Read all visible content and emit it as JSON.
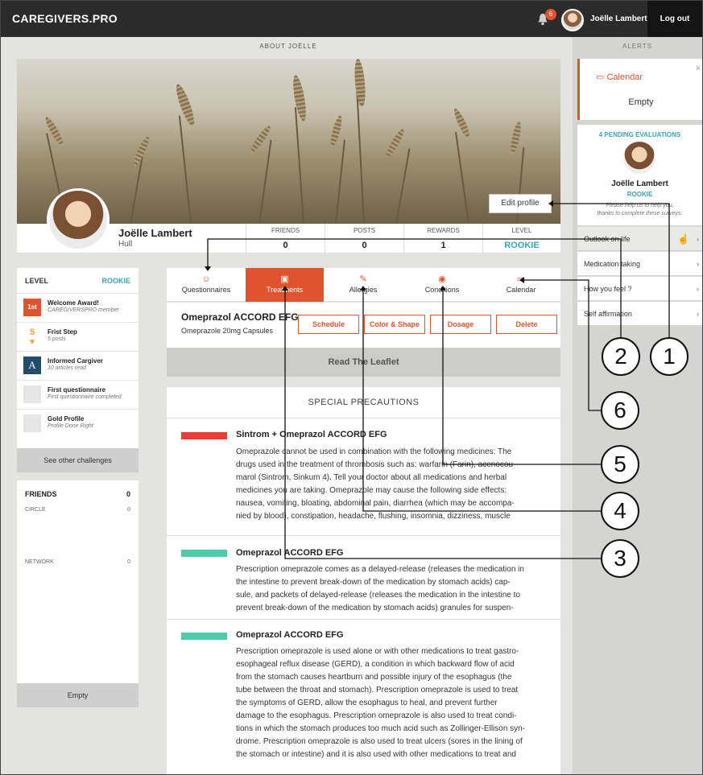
{
  "topbar": {
    "brand": "CAREGIVERS.PRO",
    "notifications": "6",
    "user": "Joëlle Lambert",
    "logout": "Log out"
  },
  "about_header": "ABOUT JOËLLE",
  "alerts_header": "ALERTS",
  "profile": {
    "name": "Joëlle Lambert",
    "city": "Hull",
    "edit_label": "Edit profile",
    "stats": [
      {
        "label": "FRIENDS",
        "value": "0"
      },
      {
        "label": "POSTS",
        "value": "0"
      },
      {
        "label": "REWARDS",
        "value": "1"
      },
      {
        "label": "LEVEL",
        "value": "ROOKIE"
      }
    ]
  },
  "level_box": {
    "title": "LEVEL",
    "value": "ROOKIE",
    "achievements": [
      {
        "icon": "1st",
        "title": "Welcome Award!",
        "sub": "CAREGIVERSPRO  member"
      },
      {
        "icon": "5",
        "title": "Frist Step",
        "sub": "5 posts"
      },
      {
        "icon": "A",
        "title": "Informed Cargiver",
        "sub": "10 articles read"
      },
      {
        "icon": "",
        "title": "First questionnaire",
        "sub": "First questionnaire completed"
      },
      {
        "icon": "",
        "title": "Gold Profile",
        "sub": "Profile Done Right"
      }
    ],
    "see_other": "See other challenges"
  },
  "friends_box": {
    "title": "FRIENDS",
    "count": "0",
    "circle_label": "CIRCLE",
    "circle_count": "0",
    "network_label": "NETWORK",
    "network_count": "0",
    "empty": "Empty"
  },
  "tabs": [
    {
      "icon": "☺",
      "label": "Questionnaires"
    },
    {
      "icon": "▣",
      "label": "Treatments"
    },
    {
      "icon": "✎",
      "label": "Allergies"
    },
    {
      "icon": "◉",
      "label": "Conditions"
    },
    {
      "icon": "▭",
      "label": "Calendar"
    }
  ],
  "medication": {
    "name": "Omeprazol ACCORD EFG",
    "sub": "Omeprazole 20mg Capsules",
    "buttons": [
      "Schedule",
      "Color & Shape",
      "Dosage",
      "Delete"
    ],
    "leaflet": "Read The Leaflet"
  },
  "precautions": {
    "title": "SPECIAL PRECAUTIONS",
    "colors": {
      "danger": "#ee3d32",
      "ok": "#4ecba8"
    },
    "sections": [
      {
        "title": "Sintrom + Omeprazol ACCORD EFG",
        "lines": [
          "Omeprazole cannot be used in combination with the following medicines: The",
          "drugs used in the treatment of thrombosis such as: warfarin (Farin), acenocou-",
          "marol (Sintrom, Sinkum 4). Tell your doctor about all medications and herbal",
          "medicines you are taking. Omeprazole may cause the following side effects:",
          "nausea, vomiting, bloating, abdominal pain, diarrhea (which may be accompa-",
          "nied by blood), constipation, headache, flushing, insomnia, dizziness, muscle"
        ]
      },
      {
        "title": "Omeprazol ACCORD EFG",
        "lines": [
          "Prescription omeprazole comes as a delayed-release (releases the medication in",
          "the intestine to prevent break-down of the medication by stomach acids) cap-",
          "sule, and packets of delayed-release (releases the medication in the intestine to",
          "prevent break-down of the medication by stomach acids) granules for suspen-"
        ]
      },
      {
        "title": "Omeprazol ACCORD EFG",
        "lines": [
          "Prescription omeprazole is used alone or with other medications to treat gastro-",
          "esophageal reflux disease (GERD), a condition in which backward flow of acid",
          "from the stomach causes heartburn and possible injury of the esophagus (the",
          "tube between the throat and stomach). Prescription omeprazole is used to treat",
          "the symptoms of GERD, allow the esophagus to heal, and prevent further",
          "damage to the esophagus. Prescription omeprazole is also used to treat condi-",
          "tions in which the stomach produces too much acid such as Zollinger-Ellison syn-",
          "drome. Prescription omeprazole is also used to treat ulcers (sores in the lining of",
          "the stomach or intestine) and it is also used with other medications to treat and"
        ]
      }
    ]
  },
  "alerts": {
    "calendar_title": "Calendar",
    "calendar_state": "Empty",
    "close": "×",
    "pending": "4 PENDING EVALUATIONS",
    "eval_name": "Joëlle Lambert",
    "eval_level": "ROOKIE",
    "help_line1": "Please help us to help you,",
    "help_line2": "thanks to complete these surveys:",
    "surveys": [
      "Outlook on life",
      "Medication taking",
      "How you feel ?",
      "Self affirmation"
    ],
    "chevron": "›"
  },
  "callouts": [
    "1",
    "2",
    "3",
    "4",
    "5",
    "6"
  ]
}
